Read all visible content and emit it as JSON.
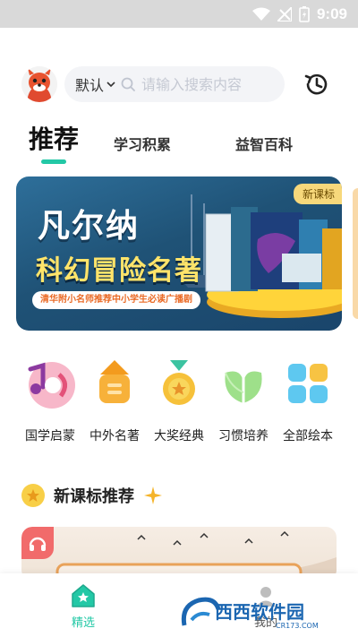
{
  "status_bar": {
    "time": "9:09"
  },
  "search": {
    "mode": "默认",
    "placeholder": "请输入搜索内容"
  },
  "tabs": [
    {
      "label": "推荐",
      "active": true
    },
    {
      "label": "学习积累",
      "active": false
    },
    {
      "label": "益智百科",
      "active": false
    }
  ],
  "banner": {
    "tag": "新课标",
    "title_line1": "凡尔纳",
    "title_line2": "科幻冒险名著",
    "subtitle": "清华附小名师推荐中小学生必读广播剧"
  },
  "categories": [
    {
      "label": "国学启蒙",
      "icon": "guoxue-icon"
    },
    {
      "label": "中外名著",
      "icon": "mingzhu-icon"
    },
    {
      "label": "大奖经典",
      "icon": "medal-icon"
    },
    {
      "label": "习惯培养",
      "icon": "leaf-icon"
    },
    {
      "label": "全部绘本",
      "icon": "grid-icon"
    }
  ],
  "section": {
    "title": "新课标推荐"
  },
  "bottom_nav": [
    {
      "label": "精选",
      "active": true
    },
    {
      "label": "我的",
      "active": false
    }
  ],
  "watermark": {
    "text": "西西软件园",
    "sub": "CR173.COM"
  },
  "colors": {
    "accent": "#23c8a6",
    "tag": "#f7d87b",
    "banner_title2": "#ffe46a"
  }
}
